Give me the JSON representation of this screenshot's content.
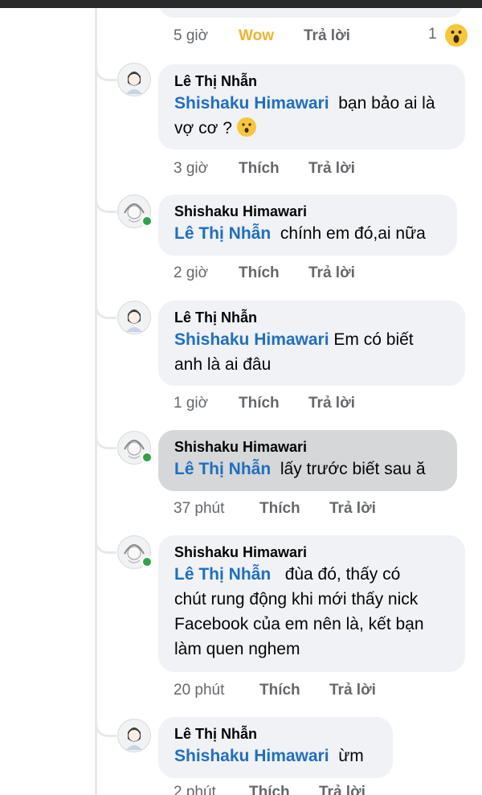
{
  "reaction": {
    "wow_label": "Wow",
    "count": "1",
    "icon": "wow-reaction-icon"
  },
  "labels": {
    "like": "Thích",
    "reply": "Trả lời"
  },
  "comments": [
    {
      "time": "5 giờ"
    },
    {
      "author": "Lê Thị Nhẫn",
      "mention": "Shishaku Himawari",
      "text_a": "bạn bảo ai là",
      "text_b": "vợ cơ ?",
      "time": "3 giờ",
      "emoji": "hushed-face-emoji"
    },
    {
      "author": "Shishaku Himawari",
      "mention": "Lê Thị Nhẫn",
      "text_a": "chính em đó,ai nữa",
      "time": "2 giờ"
    },
    {
      "author": "Lê Thị Nhẫn",
      "mention": "Shishaku Himawari",
      "text_a": "Em có biết",
      "text_b": "anh là ai đâu",
      "time": "1 giờ"
    },
    {
      "author": "Shishaku Himawari",
      "mention": "Lê Thị Nhẫn",
      "text_a": "lấy trước biết sau ă",
      "time": "37 phút"
    },
    {
      "author": "Shishaku Himawari",
      "mention": "Lê Thị Nhẫn",
      "text_a": "đùa đó, thấy có",
      "text_b": "chút rung động khi mới thấy nick",
      "text_c": "Facebook của em nên là, kết bạn",
      "text_d": "làm quen nghem",
      "time": "20 phút"
    },
    {
      "author": "Lê Thị Nhẫn",
      "mention": "Shishaku Himawari",
      "text_a": "ừm",
      "time": "2 phút"
    }
  ],
  "colors": {
    "mention": "#1f6fbf",
    "bubble": "#f0f2f5",
    "selected_bubble": "#d6d7d9",
    "online": "#31a24c",
    "wow": "#f2b32b"
  }
}
